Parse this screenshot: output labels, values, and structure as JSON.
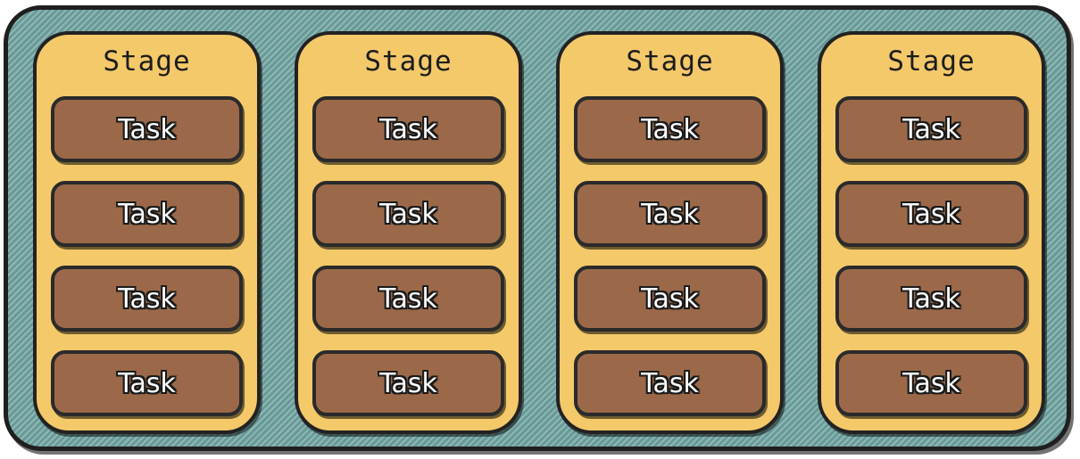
{
  "pipeline": {
    "stages": [
      {
        "title": "Stage",
        "tasks": [
          "Task",
          "Task",
          "Task",
          "Task"
        ]
      },
      {
        "title": "Stage",
        "tasks": [
          "Task",
          "Task",
          "Task",
          "Task"
        ]
      },
      {
        "title": "Stage",
        "tasks": [
          "Task",
          "Task",
          "Task",
          "Task"
        ]
      },
      {
        "title": "Stage",
        "tasks": [
          "Task",
          "Task",
          "Task",
          "Task"
        ]
      }
    ]
  },
  "colors": {
    "pipeline_fill": "#6fa3a0",
    "stage_fill": "#f4c96a",
    "task_fill": "#9b6949",
    "outline": "#222222",
    "task_text": "#ffffff"
  }
}
